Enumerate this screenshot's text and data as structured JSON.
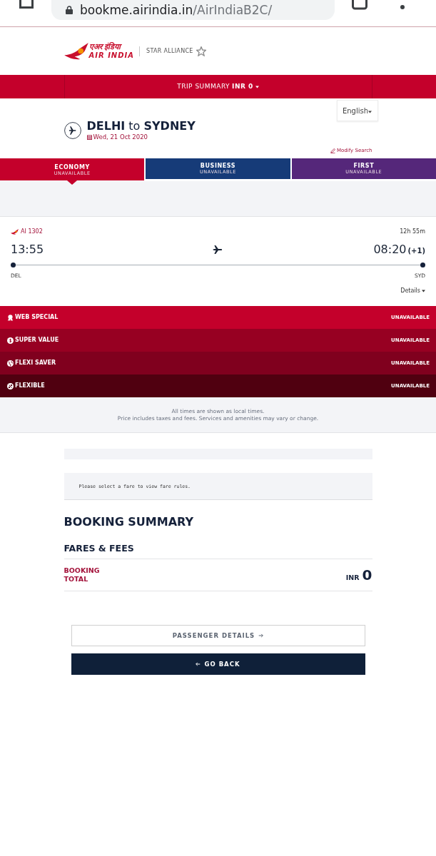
{
  "browser": {
    "host": "bookme.airindia.in",
    "path": "/AirIndiaB2C/"
  },
  "header": {
    "brand_hindi": "एअर इंडिया",
    "brand": "AIR INDIA",
    "alliance": "STAR ALLIANCE"
  },
  "trip_summary": {
    "label": "TRIP SUMMARY",
    "amount": "INR 0"
  },
  "language": {
    "value": "English"
  },
  "route": {
    "title": "**DELHI** to **SYDNEY**",
    "date": "Wed, 21 Oct 2020",
    "modify_link": "Modify Search"
  },
  "cabins": [
    {
      "name": "ECONOMY",
      "status": "UNAVAILABLE",
      "selected": true,
      "color": "#c4002b"
    },
    {
      "name": "BUSINESS",
      "status": "UNAVAILABLE",
      "selected": false,
      "color": "#163b78"
    },
    {
      "name": "FIRST",
      "status": "UNAVAILABLE",
      "selected": false,
      "color": "#55277a"
    }
  ],
  "flight": {
    "number": "AI 1302",
    "duration": "12h 55m",
    "departure_time": "13:55",
    "arrival_time": "08:20",
    "day_offset": "(+1)",
    "origin": "DEL",
    "destination": "SYD",
    "details_link": "Details"
  },
  "fares": [
    {
      "name": "WEB SPECIAL",
      "status": "UNAVAILABLE",
      "color": "#c4002b"
    },
    {
      "name": "SUPER VALUE",
      "status": "UNAVAILABLE",
      "color": "#970022"
    },
    {
      "name": "FLEXI SAVER",
      "status": "UNAVAILABLE",
      "color": "#80001e"
    },
    {
      "name": "FLEXIBLE",
      "status": "UNAVAILABLE",
      "color": "#500010"
    }
  ],
  "notes": [
    "All times are shown as local times.",
    "Price includes taxes and fees. Services and amenities may vary or change."
  ],
  "fare_rules": {
    "message": "Please select a fare to view fare rules."
  },
  "booking_summary": {
    "title": "BOOKING SUMMARY",
    "section": "FARES & FEES",
    "total_label": "BOOKING TOTAL",
    "currency": "INR",
    "total": "0"
  },
  "buttons": [
    {
      "label": "PASSENGER DETAILS",
      "kind": "next"
    },
    {
      "label": "GO BACK",
      "kind": "back"
    }
  ]
}
